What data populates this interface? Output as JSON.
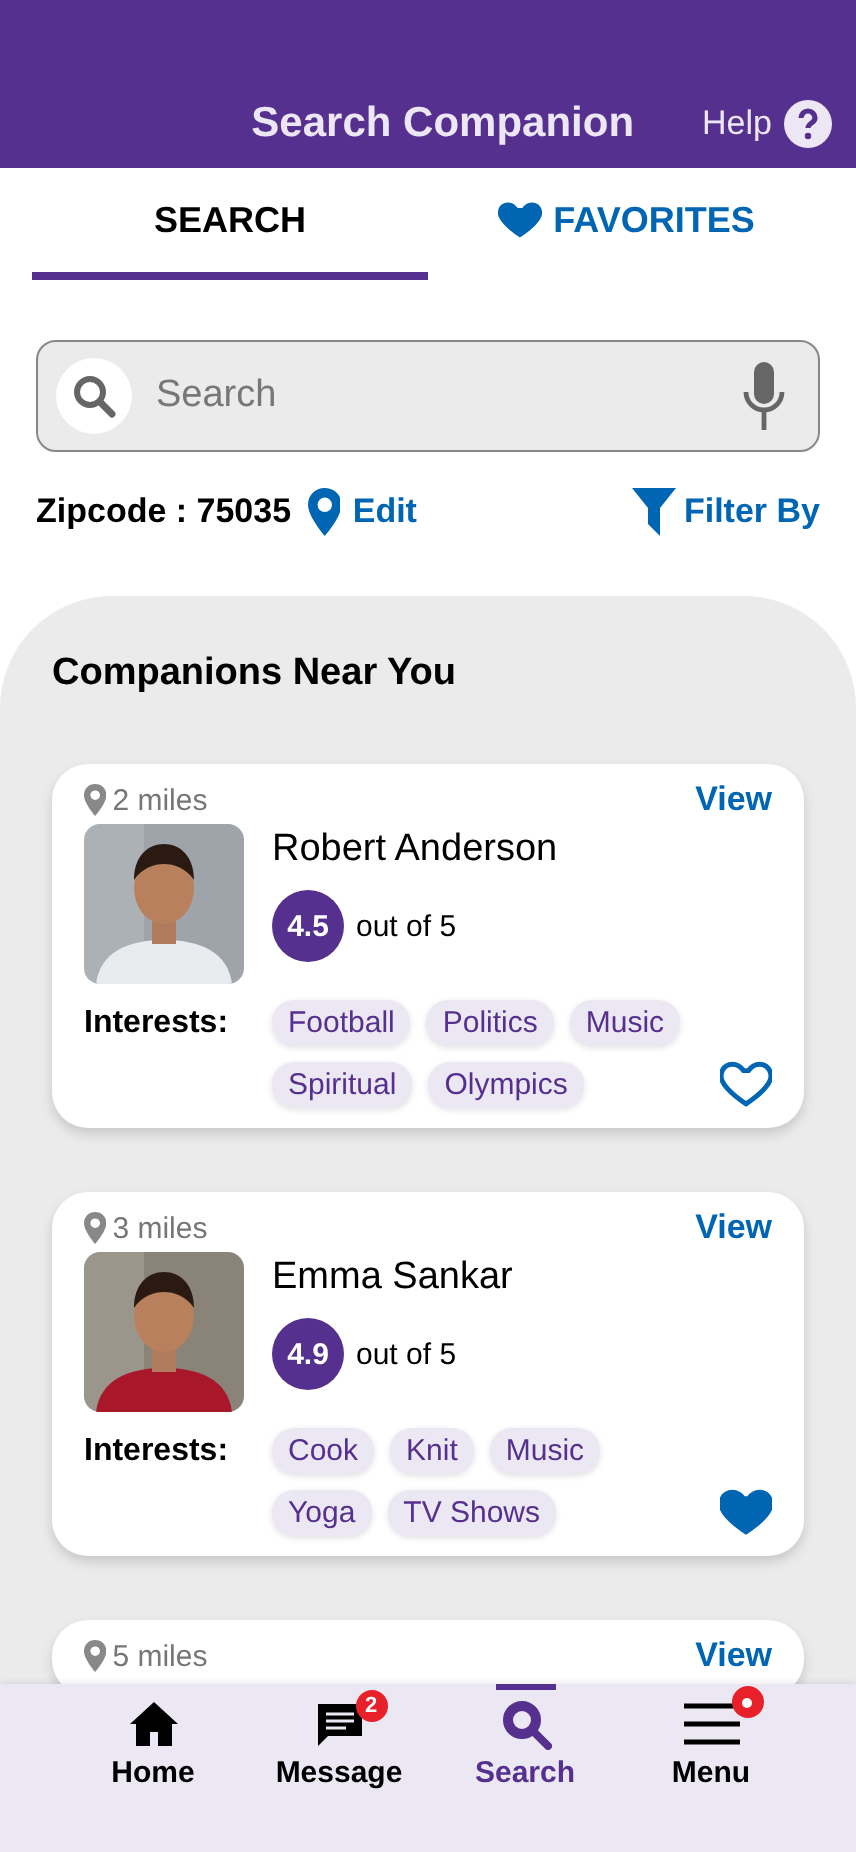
{
  "header": {
    "title": "Search Companion",
    "help": "Help"
  },
  "tabs": [
    {
      "label": "SEARCH",
      "selected": true
    },
    {
      "label": "FAVORITES",
      "selected": false
    }
  ],
  "search": {
    "placeholder": "Search"
  },
  "location": {
    "zipcode": "Zipcode : 75035",
    "edit": "Edit",
    "filter": "Filter By"
  },
  "section_title": "Companions Near You",
  "companions": [
    {
      "distance": "2 miles",
      "view": "View",
      "name": "Robert Anderson",
      "rating": "4.5",
      "rating_suffix": "out of 5",
      "interests_label": "Interests:",
      "interests": [
        "Football",
        "Politics",
        "Music",
        "Spiritual",
        "Olympics"
      ],
      "favorite": false
    },
    {
      "distance": "3 miles",
      "view": "View",
      "name": "Emma Sankar",
      "rating": "4.9",
      "rating_suffix": "out of 5",
      "interests_label": "Interests:",
      "interests": [
        "Cook",
        "Knit",
        "Music",
        "Yoga",
        "TV Shows"
      ],
      "favorite": true
    },
    {
      "distance": "5 miles",
      "view": "View"
    }
  ],
  "nav": [
    {
      "label": "Home",
      "selected": false
    },
    {
      "label": "Message",
      "selected": false,
      "badge": "2"
    },
    {
      "label": "Search",
      "selected": true
    },
    {
      "label": "Menu",
      "selected": false,
      "dot": true
    }
  ]
}
